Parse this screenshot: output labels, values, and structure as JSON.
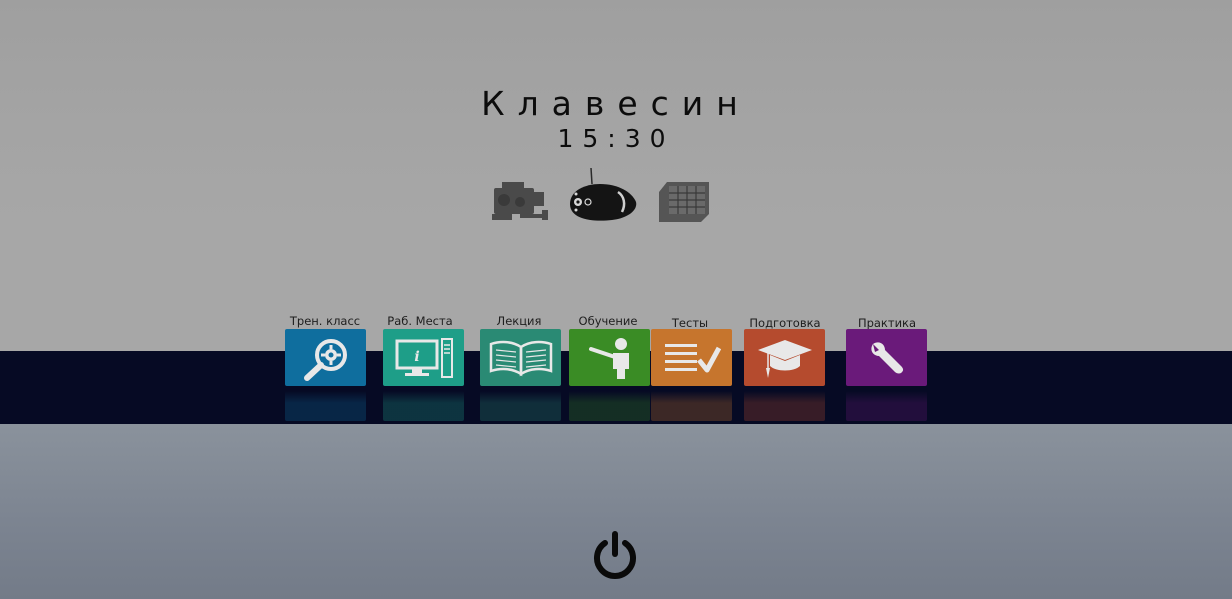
{
  "header": {
    "title": "Клавесин",
    "time": "15:30"
  },
  "devices": [
    {
      "name": "camera-device"
    },
    {
      "name": "vehicle-device",
      "selected": true
    },
    {
      "name": "grid-box-device"
    }
  ],
  "apps": [
    {
      "label": "Трен. класс",
      "color": "#0f6e9e",
      "icon": "magnifier-gear-icon"
    },
    {
      "label": "Раб. Места",
      "color": "#1e9e88",
      "icon": "workstation-icon"
    },
    {
      "label": "Лекция",
      "color": "#2a8a74",
      "icon": "book-icon"
    },
    {
      "label": "Обучение",
      "color": "#3a8c25",
      "icon": "teacher-icon"
    },
    {
      "label": "Тесты",
      "color": "#c6752d",
      "icon": "checklist-icon"
    },
    {
      "label": "Подготовка",
      "color": "#b54b2e",
      "icon": "graduation-cap-icon"
    },
    {
      "label": "Практика",
      "color": "#6a1a7a",
      "icon": "wrench-icon"
    }
  ],
  "colors": {
    "band": "#060a24",
    "text": "#0c0c0c"
  },
  "power": {
    "icon": "power-icon"
  }
}
